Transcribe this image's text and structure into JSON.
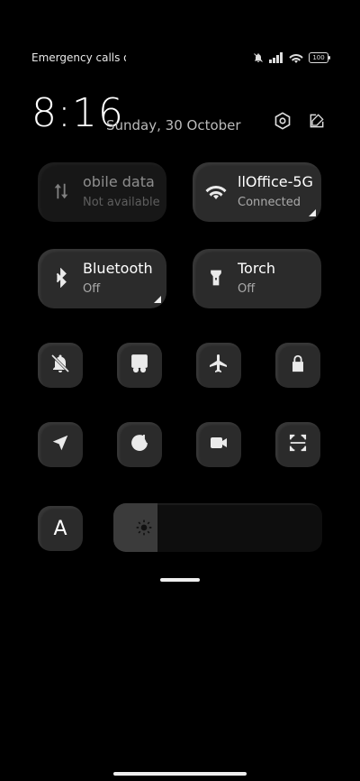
{
  "status": {
    "carrier_text": "Emergency calls o",
    "battery": "100"
  },
  "header": {
    "time": "8:16",
    "date": "Sunday, 30 October"
  },
  "tiles": {
    "mobile": {
      "title": "obile data",
      "sub": "Not available"
    },
    "wifi": {
      "title": "llOffice-5G",
      "sub": "Connected"
    },
    "bluetooth": {
      "title": "Bluetooth",
      "sub": "Off"
    },
    "torch": {
      "title": "Torch",
      "sub": "Off"
    }
  },
  "font_button": {
    "label": "A"
  },
  "brightness": {
    "level": 0.21
  }
}
